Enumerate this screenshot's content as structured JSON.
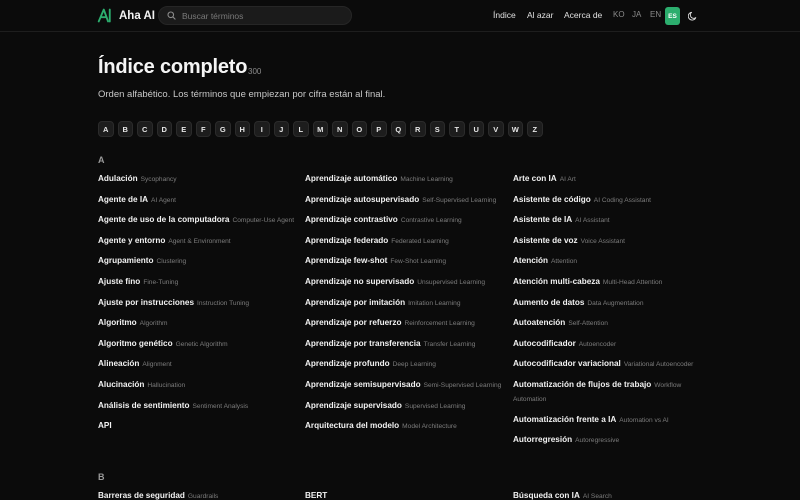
{
  "header": {
    "logo_text": "Aha AI",
    "search_placeholder": "Buscar términos",
    "nav": {
      "index": "Índice",
      "random": "Al azar",
      "about": "Acerca de"
    },
    "languages": [
      "KO",
      "JA",
      "EN"
    ],
    "active_language": "ES",
    "brand_color": "#2cae6e"
  },
  "main": {
    "title": "Índice completo",
    "count": "300",
    "subtitle": "Orden alfabético. Los términos que empiezan por cifra están al final."
  },
  "alphabet": [
    "A",
    "B",
    "C",
    "D",
    "E",
    "F",
    "G",
    "H",
    "I",
    "J",
    "L",
    "M",
    "N",
    "O",
    "P",
    "Q",
    "R",
    "S",
    "T",
    "U",
    "V",
    "W",
    "Z"
  ],
  "sections": {
    "a": {
      "letter": "A",
      "col1": [
        {
          "es": "Adulación",
          "en": "Sycophancy"
        },
        {
          "es": "Agente de IA",
          "en": "AI Agent"
        },
        {
          "es": "Agente de uso de la computadora",
          "en": "Computer-Use Agent"
        },
        {
          "es": "Agente y entorno",
          "en": "Agent & Environment"
        },
        {
          "es": "Agrupamiento",
          "en": "Clustering"
        },
        {
          "es": "Ajuste fino",
          "en": "Fine-Tuning"
        },
        {
          "es": "Ajuste por instrucciones",
          "en": "Instruction Tuning"
        },
        {
          "es": "Algoritmo",
          "en": "Algorithm"
        },
        {
          "es": "Algoritmo genético",
          "en": "Genetic Algorithm"
        },
        {
          "es": "Alineación",
          "en": "Alignment"
        },
        {
          "es": "Alucinación",
          "en": "Hallucination"
        },
        {
          "es": "Análisis de sentimiento",
          "en": "Sentiment Analysis"
        },
        {
          "es": "API",
          "en": ""
        }
      ],
      "col2": [
        {
          "es": "Aprendizaje automático",
          "en": "Machine Learning"
        },
        {
          "es": "Aprendizaje autosupervisado",
          "en": "Self-Supervised Learning"
        },
        {
          "es": "Aprendizaje contrastivo",
          "en": "Contrastive Learning"
        },
        {
          "es": "Aprendizaje federado",
          "en": "Federated Learning"
        },
        {
          "es": "Aprendizaje few-shot",
          "en": "Few-Shot Learning"
        },
        {
          "es": "Aprendizaje no supervisado",
          "en": "Unsupervised Learning"
        },
        {
          "es": "Aprendizaje por imitación",
          "en": "Imitation Learning"
        },
        {
          "es": "Aprendizaje por refuerzo",
          "en": "Reinforcement Learning"
        },
        {
          "es": "Aprendizaje por transferencia",
          "en": "Transfer Learning"
        },
        {
          "es": "Aprendizaje profundo",
          "en": "Deep Learning"
        },
        {
          "es": "Aprendizaje semisupervisado",
          "en": "Semi-Supervised Learning"
        },
        {
          "es": "Aprendizaje supervisado",
          "en": "Supervised Learning"
        },
        {
          "es": "Arquitectura del modelo",
          "en": "Model Architecture"
        }
      ],
      "col3": [
        {
          "es": "Arte con IA",
          "en": "AI Art"
        },
        {
          "es": "Asistente de código",
          "en": "AI Coding Assistant"
        },
        {
          "es": "Asistente de IA",
          "en": "AI Assistant"
        },
        {
          "es": "Asistente de voz",
          "en": "Voice Assistant"
        },
        {
          "es": "Atención",
          "en": "Attention"
        },
        {
          "es": "Atención multi-cabeza",
          "en": "Multi-Head Attention"
        },
        {
          "es": "Aumento de datos",
          "en": "Data Augmentation"
        },
        {
          "es": "Autoatención",
          "en": "Self-Attention"
        },
        {
          "es": "Autocodificador",
          "en": "Autoencoder"
        },
        {
          "es": "Autocodificador variacional",
          "en": "Variational Autoencoder"
        },
        {
          "es": "Automatización de flujos de trabajo",
          "en": "Workflow Automation"
        },
        {
          "es": "Automatización frente a IA",
          "en": "Automation vs AI"
        },
        {
          "es": "Autorregresión",
          "en": "Autoregressive"
        }
      ]
    },
    "b": {
      "letter": "B",
      "col1": [
        {
          "es": "Barreras de seguridad",
          "en": "Guardrails"
        }
      ],
      "col2": [
        {
          "es": "BERT",
          "en": ""
        }
      ],
      "col3": [
        {
          "es": "Búsqueda con IA",
          "en": "AI Search"
        }
      ]
    }
  }
}
